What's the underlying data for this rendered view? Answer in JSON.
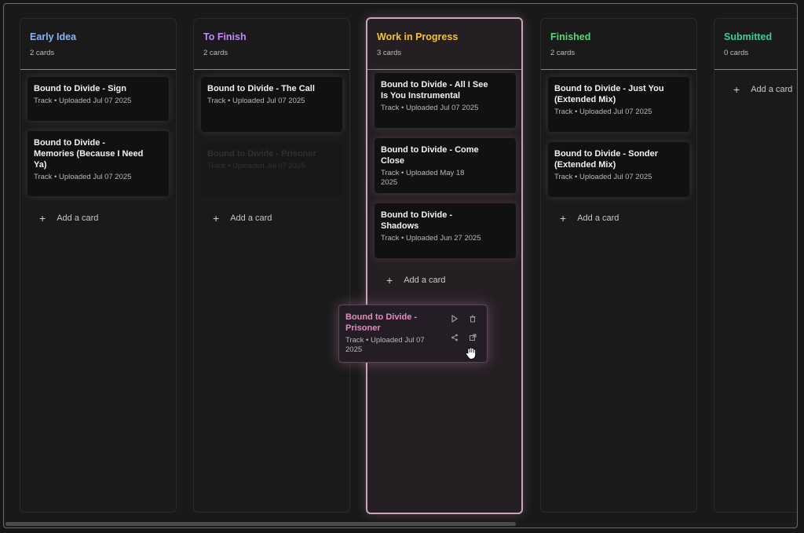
{
  "columns": [
    {
      "title": "Early Idea",
      "count": "2 cards",
      "color": "#8ab4f8",
      "cards": [
        {
          "title": "Bound to Divide - Sign",
          "meta": "Track • Uploaded Jul 07 2025"
        },
        {
          "title": "Bound to Divide - Memories (Because I Need Ya)",
          "meta": "Track • Uploaded Jul 07 2025"
        }
      ],
      "add_label": "Add a card"
    },
    {
      "title": "To Finish",
      "count": "2 cards",
      "color": "#c58af9",
      "cards": [
        {
          "title": "Bound to Divide - The Call",
          "meta": "Track • Uploaded Jul 07 2025"
        },
        {
          "title": "Bound to Divide - Prisoner",
          "meta": "Track • Uploaded Jul 07 2025",
          "ghost": true
        }
      ],
      "add_label": "Add a card"
    },
    {
      "title": "Work in Progress",
      "count": "3 cards",
      "color": "#f3c23c",
      "cards": [
        {
          "title": "Bound to Divide - All I See Is You Instrumental",
          "meta": "Track • Uploaded Jul 07 2025"
        },
        {
          "title": "Bound to Divide - Come Close",
          "meta": "Track • Uploaded May 18 2025"
        },
        {
          "title": "Bound to Divide - Shadows",
          "meta": "Track • Uploaded Jun 27 2025"
        }
      ],
      "add_label": "Add a card"
    },
    {
      "title": "Finished",
      "count": "2 cards",
      "color": "#5fd47e",
      "cards": [
        {
          "title": "Bound to Divide - Just You (Extended Mix)",
          "meta": "Track • Uploaded Jul 07 2025"
        },
        {
          "title": "Bound to Divide - Sonder (Extended Mix)",
          "meta": "Track • Uploaded Jul 07 2025"
        }
      ],
      "add_label": "Add a card"
    },
    {
      "title": "Submitted",
      "count": "0 cards",
      "color": "#45c7a6",
      "cards": [],
      "add_label": "Add a card"
    }
  ],
  "dragging_card": {
    "title": "Bound to Divide - Prisoner",
    "meta": "Track • Uploaded Jul 07 2025",
    "icons": [
      "play-icon",
      "trash-icon",
      "share-icon",
      "external-link-icon"
    ]
  }
}
